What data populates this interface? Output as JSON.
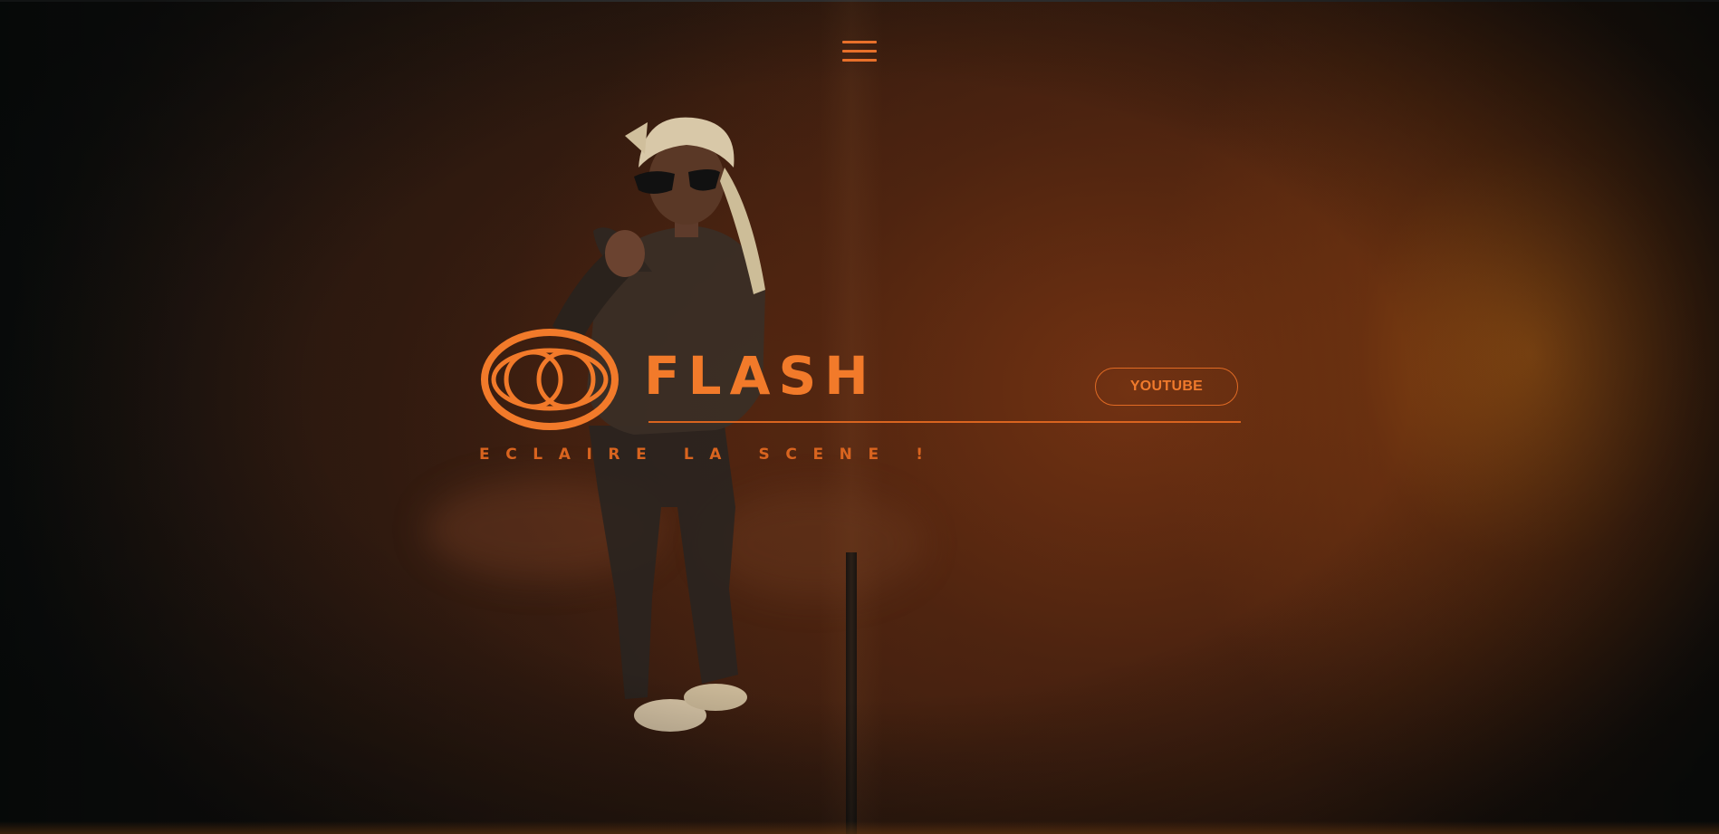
{
  "header": {
    "menu_icon": "hamburger-menu-icon"
  },
  "brand": {
    "logo_icon": "eye-logo-icon",
    "title": "FLASH",
    "tagline": "ECLAIRE LA SCENE !"
  },
  "actions": {
    "youtube_label": "YOUTUBE"
  },
  "colors": {
    "accent": "#f27a2a",
    "background_dark": "#0d0f0e",
    "background_warm": "#4a2510"
  }
}
